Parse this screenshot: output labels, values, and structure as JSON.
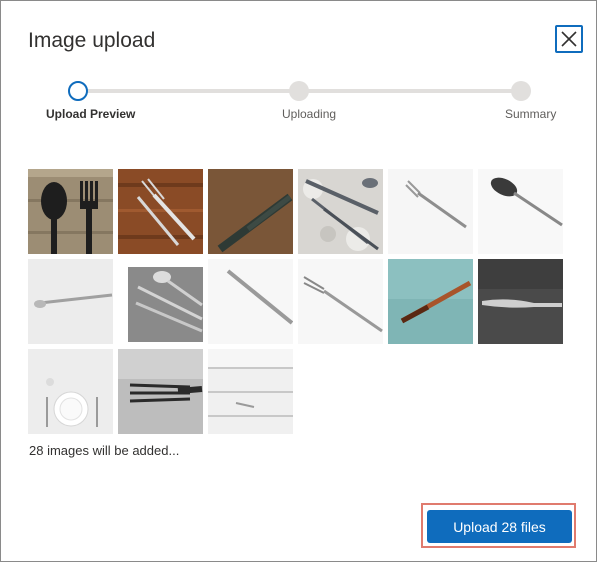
{
  "dialog": {
    "title": "Image upload",
    "close_icon": "close-icon"
  },
  "steps": [
    {
      "label": "Upload Preview",
      "state": "active"
    },
    {
      "label": "Uploading",
      "state": "pending"
    },
    {
      "label": "Summary",
      "state": "pending"
    }
  ],
  "images": [
    {
      "name": "black-spoon-fork"
    },
    {
      "name": "fork-knife-on-wood"
    },
    {
      "name": "knife-on-brown"
    },
    {
      "name": "cutlery-on-lace"
    },
    {
      "name": "fork-white"
    },
    {
      "name": "spoon-white"
    },
    {
      "name": "fork-tilted-white"
    },
    {
      "name": "cutlery-set-grey"
    },
    {
      "name": "knife-white"
    },
    {
      "name": "fork-diagonal-white"
    },
    {
      "name": "copper-handle-teal"
    },
    {
      "name": "knife-dark"
    },
    {
      "name": "plate-setting"
    },
    {
      "name": "fork-closeup-grey"
    },
    {
      "name": "white-wood-planks"
    }
  ],
  "status_text": "28 images will be added...",
  "upload_button_label": "Upload 28 files",
  "colors": {
    "accent": "#0f6cbd",
    "highlight": "#e07b6e"
  }
}
